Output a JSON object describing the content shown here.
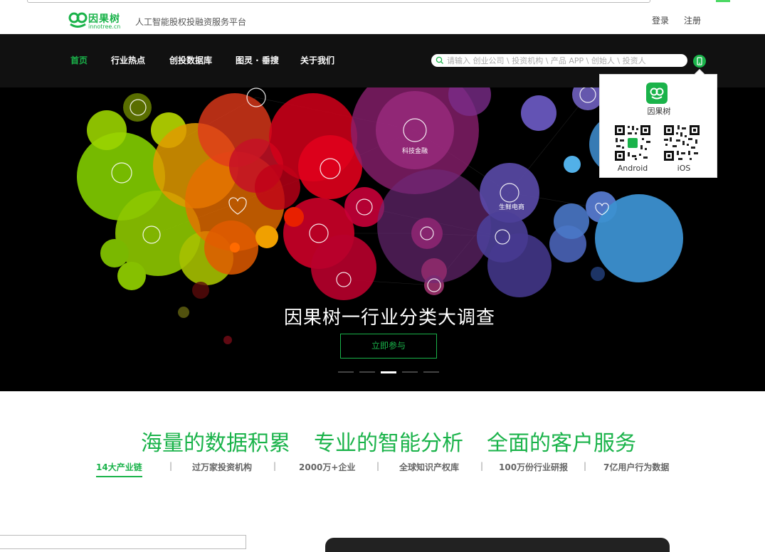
{
  "header": {
    "logo_name": "因果树",
    "logo_domain": "innotree.cn",
    "slogan": "人工智能股权投融资服务平台",
    "login": "登录",
    "register": "注册"
  },
  "nav": {
    "items": [
      "首页",
      "行业热点",
      "创投数据库",
      "图灵 · 垂搜",
      "关于我们"
    ],
    "active": "首页",
    "search_placeholder": "请输入 创业公司 \\ 投资机构 \\ 产品 APP \\ 创始人 \\ 投资人"
  },
  "qr_popup": {
    "app_name": "因果树",
    "android_label": "Android",
    "ios_label": "iOS"
  },
  "hero": {
    "bubble_labels": [
      "科技金融",
      "生鲜电商"
    ],
    "title": "因果树一行业分类大调查",
    "cta": "立即参与",
    "slides_total": 5,
    "active_slide": 3
  },
  "features": {
    "headlines": [
      "海量的数据积累",
      "专业的智能分析",
      "全面的客户服务"
    ],
    "stats": [
      "14大产业链",
      "过万家投资机构",
      "2000万+企业",
      "全球知识产权库",
      "100万份行业研报",
      "7亿用户行为数据"
    ],
    "active_stat": "14大产业链",
    "separator": "|"
  },
  "colors": {
    "brand_green": "#1ab34a",
    "nav_background": "#111111",
    "hero_background": "#000000"
  },
  "icons": [
    "search-icon",
    "mobile-phone-icon",
    "app-logo-icon",
    "qr-code-icon"
  ]
}
